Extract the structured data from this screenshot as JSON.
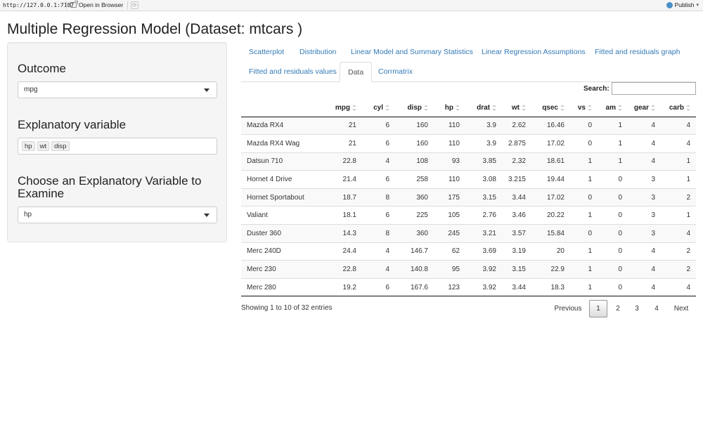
{
  "topbar": {
    "url": "http://127.0.0.1:7187",
    "open_in_browser": "Open in Browser",
    "publish": "Publish"
  },
  "page_title": "Multiple Regression Model (Dataset: mtcars )",
  "sidebar": {
    "outcome_label": "Outcome",
    "outcome_value": "mpg",
    "explanatory_label": "Explanatory variable",
    "explanatory_values": [
      "hp",
      "wt",
      "disp"
    ],
    "examine_label": "Choose an Explanatory Variable to Examine",
    "examine_value": "hp"
  },
  "tabs": [
    {
      "label": "Scatterplot",
      "active": false
    },
    {
      "label": "Distribution",
      "active": false
    },
    {
      "label": "Linear Model and Summary Statistics",
      "active": false
    },
    {
      "label": "Linear Regression Assumptions",
      "active": false
    },
    {
      "label": "Fitted and residuals graph",
      "active": false
    },
    {
      "label": "Fitted and residuals values",
      "active": false
    },
    {
      "label": "Data",
      "active": true
    },
    {
      "label": "Corrmatrix",
      "active": false
    }
  ],
  "search": {
    "label": "Search:",
    "value": ""
  },
  "table": {
    "columns": [
      "",
      "mpg",
      "cyl",
      "disp",
      "hp",
      "drat",
      "wt",
      "qsec",
      "vs",
      "am",
      "gear",
      "carb"
    ],
    "rows": [
      [
        "Mazda RX4",
        "21",
        "6",
        "160",
        "110",
        "3.9",
        "2.62",
        "16.46",
        "0",
        "1",
        "4",
        "4"
      ],
      [
        "Mazda RX4 Wag",
        "21",
        "6",
        "160",
        "110",
        "3.9",
        "2.875",
        "17.02",
        "0",
        "1",
        "4",
        "4"
      ],
      [
        "Datsun 710",
        "22.8",
        "4",
        "108",
        "93",
        "3.85",
        "2.32",
        "18.61",
        "1",
        "1",
        "4",
        "1"
      ],
      [
        "Hornet 4 Drive",
        "21.4",
        "6",
        "258",
        "110",
        "3.08",
        "3.215",
        "19.44",
        "1",
        "0",
        "3",
        "1"
      ],
      [
        "Hornet Sportabout",
        "18.7",
        "8",
        "360",
        "175",
        "3.15",
        "3.44",
        "17.02",
        "0",
        "0",
        "3",
        "2"
      ],
      [
        "Valiant",
        "18.1",
        "6",
        "225",
        "105",
        "2.76",
        "3.46",
        "20.22",
        "1",
        "0",
        "3",
        "1"
      ],
      [
        "Duster 360",
        "14.3",
        "8",
        "360",
        "245",
        "3.21",
        "3.57",
        "15.84",
        "0",
        "0",
        "3",
        "4"
      ],
      [
        "Merc 240D",
        "24.4",
        "4",
        "146.7",
        "62",
        "3.69",
        "3.19",
        "20",
        "1",
        "0",
        "4",
        "2"
      ],
      [
        "Merc 230",
        "22.8",
        "4",
        "140.8",
        "95",
        "3.92",
        "3.15",
        "22.9",
        "1",
        "0",
        "4",
        "2"
      ],
      [
        "Merc 280",
        "19.2",
        "6",
        "167.6",
        "123",
        "3.92",
        "3.44",
        "18.3",
        "1",
        "0",
        "4",
        "4"
      ]
    ]
  },
  "footer": {
    "info": "Showing 1 to 10 of 32 entries",
    "previous": "Previous",
    "pages": [
      "1",
      "2",
      "3",
      "4"
    ],
    "current_page": "1",
    "next": "Next"
  }
}
